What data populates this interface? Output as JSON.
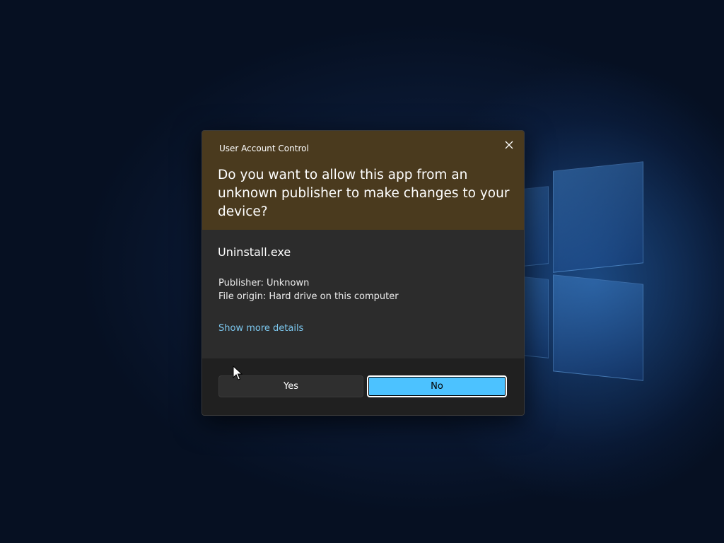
{
  "dialog": {
    "title": "User Account Control",
    "question": "Do you want to allow this app from an unknown publisher to make changes to your device?",
    "app_name": "Uninstall.exe",
    "publisher": "Publisher: Unknown",
    "file_origin": "File origin: Hard drive on this computer",
    "details_link": "Show more details",
    "yes_label": "Yes",
    "no_label": "No",
    "close_icon": "close-icon"
  },
  "colors": {
    "header_bg": "#4a3a1e",
    "body_bg": "#2c2c2c",
    "footer_bg": "#202020",
    "accent": "#4cc2ff",
    "link": "#7cc7ee"
  },
  "icons": {
    "pointer": "mouse-pointer-icon"
  }
}
